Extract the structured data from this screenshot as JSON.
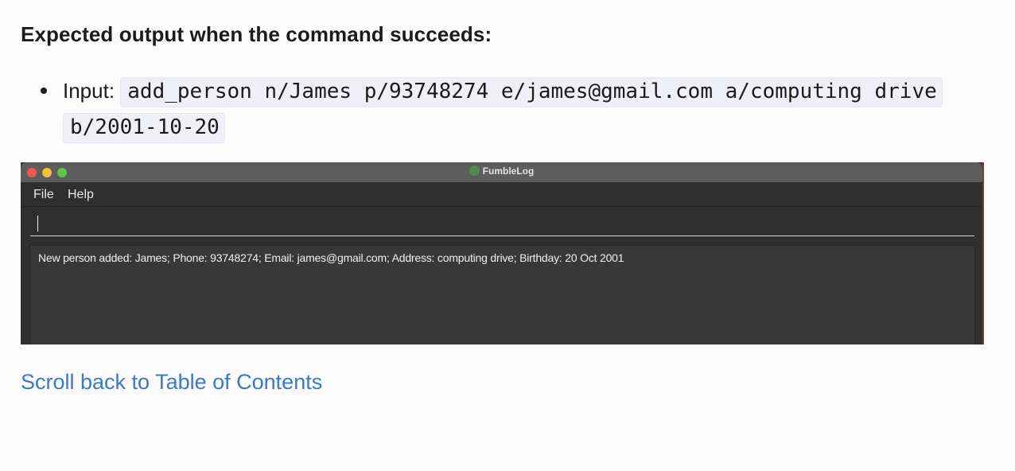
{
  "heading": "Expected output when the command succeeds:",
  "bullet": {
    "label": "Input: ",
    "command": "add_person n/James p/93748274 e/james@gmail.com a/computing drive b/2001-10-20"
  },
  "app": {
    "title": "FumbleLog",
    "menu": [
      "File",
      "Help"
    ],
    "command_value": "",
    "result_text": "New person added: James; Phone: 93748274; Email: james@gmail.com; Address: computing drive; Birthday: 20 Oct 2001",
    "colors": {
      "window_bg": "#2f2f2f",
      "titlebar": "#5d5d5d",
      "close": "#ee5a52",
      "minimize": "#f4bd3b",
      "zoom": "#5ec44a"
    }
  },
  "link": {
    "text": "Scroll back to Table of Contents",
    "color": "#3a78cf"
  }
}
